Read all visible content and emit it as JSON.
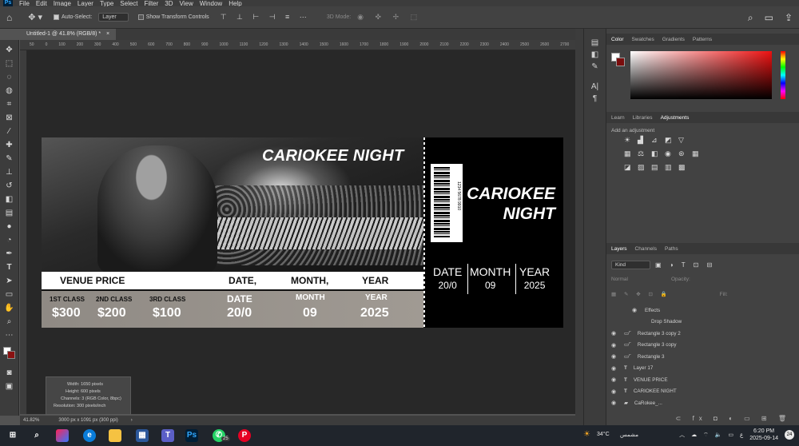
{
  "menubar": {
    "app_logo": "Ps",
    "items": [
      "File",
      "Edit",
      "Image",
      "Layer",
      "Type",
      "Select",
      "Filter",
      "3D",
      "View",
      "Window",
      "Help"
    ]
  },
  "options": {
    "auto_select_label": "Auto-Select:",
    "auto_select_value": "Layer",
    "show_transform_label": "Show Transform Controls",
    "mode_3d_label": "3D Mode:"
  },
  "document": {
    "tab_title": "Untitled-1 @ 41.8% (RGB/8) *",
    "ruler_ticks": [
      "50",
      "0",
      "100",
      "200",
      "300",
      "400",
      "500",
      "600",
      "700",
      "800",
      "900",
      "1000",
      "1100",
      "1200",
      "1300",
      "1400",
      "1500",
      "1600",
      "1700",
      "1800",
      "1900",
      "2000",
      "2100",
      "2200",
      "2300",
      "2400",
      "2500",
      "2600",
      "2700",
      "2800",
      "2900",
      "3000"
    ]
  },
  "ticket": {
    "title": "CARIOKEE NIGHT",
    "header": {
      "venue_price": "VENUE PRICE",
      "date": "DATE,",
      "month": "MONTH,",
      "year": "YEAR"
    },
    "classes": [
      {
        "label": "1ST CLASS",
        "price": "$300"
      },
      {
        "label": "2ND CLASS",
        "price": "$200"
      },
      {
        "label": "3RD CLASS",
        "price": "$100"
      }
    ],
    "date_label": "DATE",
    "date_value": "20/0",
    "month_label": "MONTH",
    "month_value": "09",
    "year_label": "YEAR",
    "year_value": "2025",
    "stub": {
      "title_line1": "CARIOKEE",
      "title_line2": "NIGHT",
      "date_label": "DATE",
      "date_value": "20/0",
      "month_label": "MONTH",
      "month_value": "09",
      "year_label": "YEAR",
      "year_value": "2025",
      "barcode_number": "1234 5678 9910"
    }
  },
  "info_popup": {
    "width": "Width: 1650 pixels",
    "height": "Height: 600 pixels",
    "channels": "Channels: 3 (RGB Color, 8bpc)",
    "resolution": "Resolution: 300 pixels/inch"
  },
  "status": {
    "zoom": "41.82%",
    "doc_size": "3000 px x 1091 px (300 ppi)"
  },
  "color_panel": {
    "tabs": [
      "Color",
      "Swatches",
      "Gradients",
      "Patterns"
    ],
    "active": "Color",
    "foreground": "#ffffff",
    "background": "#7a0d0d"
  },
  "adjustments_panel": {
    "tabs": [
      "Learn",
      "Libraries",
      "Adjustments"
    ],
    "active": "Adjustments",
    "hint": "Add an adjustment"
  },
  "layers_panel": {
    "tabs": [
      "Layers",
      "Channels",
      "Paths"
    ],
    "active": "Layers",
    "kind_label": "Kind",
    "blend_mode": "Normal",
    "opacity_label": "Opacity:",
    "fill_label": "Fill:",
    "layers": [
      {
        "name": "Effects",
        "kind": "effects"
      },
      {
        "name": "Drop Shadow",
        "kind": "effect"
      },
      {
        "name": "Rectangle 3 copy 2",
        "kind": "shape"
      },
      {
        "name": "Rectangle 3 copy",
        "kind": "shape"
      },
      {
        "name": "Rectangle 3",
        "kind": "shape"
      },
      {
        "name": "Layer 17",
        "kind": "text"
      },
      {
        "name": "VENUE PRICE",
        "kind": "text"
      },
      {
        "name": "CARIOKEE NIGHT",
        "kind": "text"
      },
      {
        "name": "CaRokee_...",
        "kind": "smart"
      }
    ]
  },
  "taskbar": {
    "weather": "34°C",
    "weather_desc": "مشمس",
    "time": "6:20 PM",
    "date": "2025-09-14",
    "lang": "ع",
    "badge": "24",
    "whatsapp_badge": "25"
  },
  "colors": {
    "accent_ps": "#31a8ff",
    "panel_bg": "#424242",
    "canvas_bg": "#282828"
  }
}
